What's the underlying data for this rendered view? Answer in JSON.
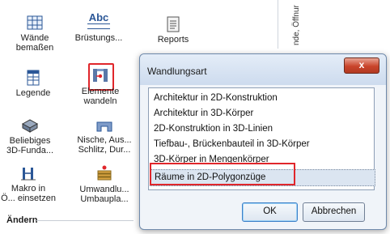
{
  "ribbon": {
    "tools": {
      "waende": "Wände\nbemaßen",
      "brustungen": "Brüstungs...",
      "reports": "Reports",
      "legende": "Legende",
      "elemente": "Elemente\nwandeln",
      "beliebiges": "Beliebiges\n3D-Funda...",
      "nische": "Nische, Aus...\nSchlitz, Dur...",
      "makro": "Makro in\nÖ... einsetzen",
      "umwandlu": "Umwandlu...\nUmbaupla..."
    },
    "vertical_text": "nde, Öffnur",
    "section_label": "Ändern",
    "abc_text": "Abc"
  },
  "dialog": {
    "title": "Wandlungsart",
    "close_label": "x",
    "options": [
      "Architektur in 2D-Konstruktion",
      "Architektur in 3D-Körper",
      "2D-Konstruktion in 3D-Linien",
      "Tiefbau-, Brückenbauteil in 3D-Körper",
      "3D-Körper in Mengenkörper",
      "Räume in 2D-Polygonzüge"
    ],
    "selected_index": 5,
    "ok_label": "OK",
    "cancel_label": "Abbrechen"
  },
  "colors": {
    "highlight": "#e0262b",
    "dialog_bg": "#f0f4f9",
    "selection_bg": "#dbe5f1"
  }
}
